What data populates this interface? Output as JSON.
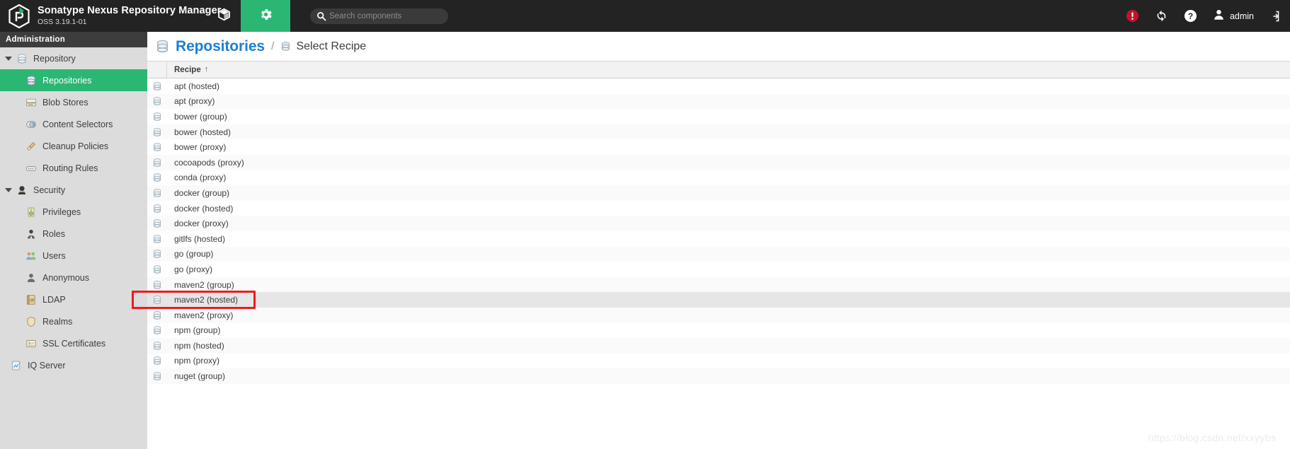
{
  "header": {
    "brand_title": "Sonatype Nexus Repository Manager",
    "brand_subtitle": "OSS 3.19.1-01",
    "logo_icon": "nexus-hexagon-logo",
    "tabs": [
      {
        "name": "browse",
        "icon": "cube-icon",
        "active": false
      },
      {
        "name": "administration",
        "icon": "gear-icon",
        "active": true
      }
    ],
    "search": {
      "placeholder": "Search components",
      "value": "",
      "icon": "search-icon"
    },
    "right_icons": [
      {
        "name": "alert-icon",
        "color": "#c4122e"
      },
      {
        "name": "refresh-icon",
        "color": "#ffffff"
      },
      {
        "name": "help-icon",
        "color": "#ffffff"
      },
      {
        "name": "user-avatar-icon",
        "color": "#ffffff"
      },
      {
        "name": "sign-out-icon",
        "color": "#ffffff"
      }
    ],
    "user_name": "admin"
  },
  "sidebar": {
    "title": "Administration",
    "items": [
      {
        "label": "Repository",
        "level": "group",
        "icon": "database-icon",
        "selected": false,
        "expanded": true
      },
      {
        "label": "Repositories",
        "level": "child",
        "icon": "repositories-icon",
        "selected": true
      },
      {
        "label": "Blob Stores",
        "level": "child",
        "icon": "blob-store-icon",
        "selected": false
      },
      {
        "label": "Content Selectors",
        "level": "child",
        "icon": "content-selector-icon",
        "selected": false
      },
      {
        "label": "Cleanup Policies",
        "level": "child",
        "icon": "broom-icon",
        "selected": false
      },
      {
        "label": "Routing Rules",
        "level": "child",
        "icon": "routing-rules-icon",
        "selected": false
      },
      {
        "label": "Security",
        "level": "group",
        "icon": "security-icon",
        "selected": false,
        "expanded": true
      },
      {
        "label": "Privileges",
        "level": "child",
        "icon": "privileges-icon",
        "selected": false
      },
      {
        "label": "Roles",
        "level": "child",
        "icon": "roles-icon",
        "selected": false
      },
      {
        "label": "Users",
        "level": "child",
        "icon": "users-icon",
        "selected": false
      },
      {
        "label": "Anonymous",
        "level": "child",
        "icon": "anonymous-icon",
        "selected": false
      },
      {
        "label": "LDAP",
        "level": "child",
        "icon": "ldap-icon",
        "selected": false
      },
      {
        "label": "Realms",
        "level": "child",
        "icon": "realms-shield-icon",
        "selected": false
      },
      {
        "label": "SSL Certificates",
        "level": "child",
        "icon": "ssl-certificate-icon",
        "selected": false
      },
      {
        "label": "IQ Server",
        "level": "lone",
        "icon": "iq-server-icon",
        "selected": false
      }
    ]
  },
  "breadcrumb": {
    "root_icon": "database-icon",
    "root_label": "Repositories",
    "separator": "/",
    "current_icon": "database-small-icon",
    "current_label": "Select Recipe"
  },
  "grid": {
    "columns": [
      {
        "key": "icon",
        "label": ""
      },
      {
        "key": "recipe",
        "label": "Recipe",
        "sorted": "asc",
        "sort_glyph": "↑"
      }
    ],
    "row_icon": "recipe-database-icon",
    "rows": [
      {
        "recipe": "apt (hosted)"
      },
      {
        "recipe": "apt (proxy)"
      },
      {
        "recipe": "bower (group)"
      },
      {
        "recipe": "bower (hosted)"
      },
      {
        "recipe": "bower (proxy)"
      },
      {
        "recipe": "cocoapods (proxy)"
      },
      {
        "recipe": "conda (proxy)"
      },
      {
        "recipe": "docker (group)"
      },
      {
        "recipe": "docker (hosted)"
      },
      {
        "recipe": "docker (proxy)"
      },
      {
        "recipe": "gitlfs (hosted)"
      },
      {
        "recipe": "go (group)"
      },
      {
        "recipe": "go (proxy)"
      },
      {
        "recipe": "maven2 (group)"
      },
      {
        "recipe": "maven2 (hosted)",
        "hovered": true
      },
      {
        "recipe": "maven2 (proxy)"
      },
      {
        "recipe": "npm (group)"
      },
      {
        "recipe": "npm (hosted)"
      },
      {
        "recipe": "npm (proxy)"
      },
      {
        "recipe": "nuget (group)"
      }
    ]
  },
  "annotation": {
    "highlight_label": "maven2 (hosted)",
    "color": "#ee1c1c"
  },
  "watermark": {
    "text": "https://blog.csdn.net/xxyybs"
  },
  "colors": {
    "header_bg": "#232323",
    "accent_green": "#2bb673",
    "sidebar_bg": "#dcdcdc",
    "link_blue": "#1c7ed6",
    "alert_red": "#c4122e",
    "annotation_red": "#ee1c1c"
  }
}
